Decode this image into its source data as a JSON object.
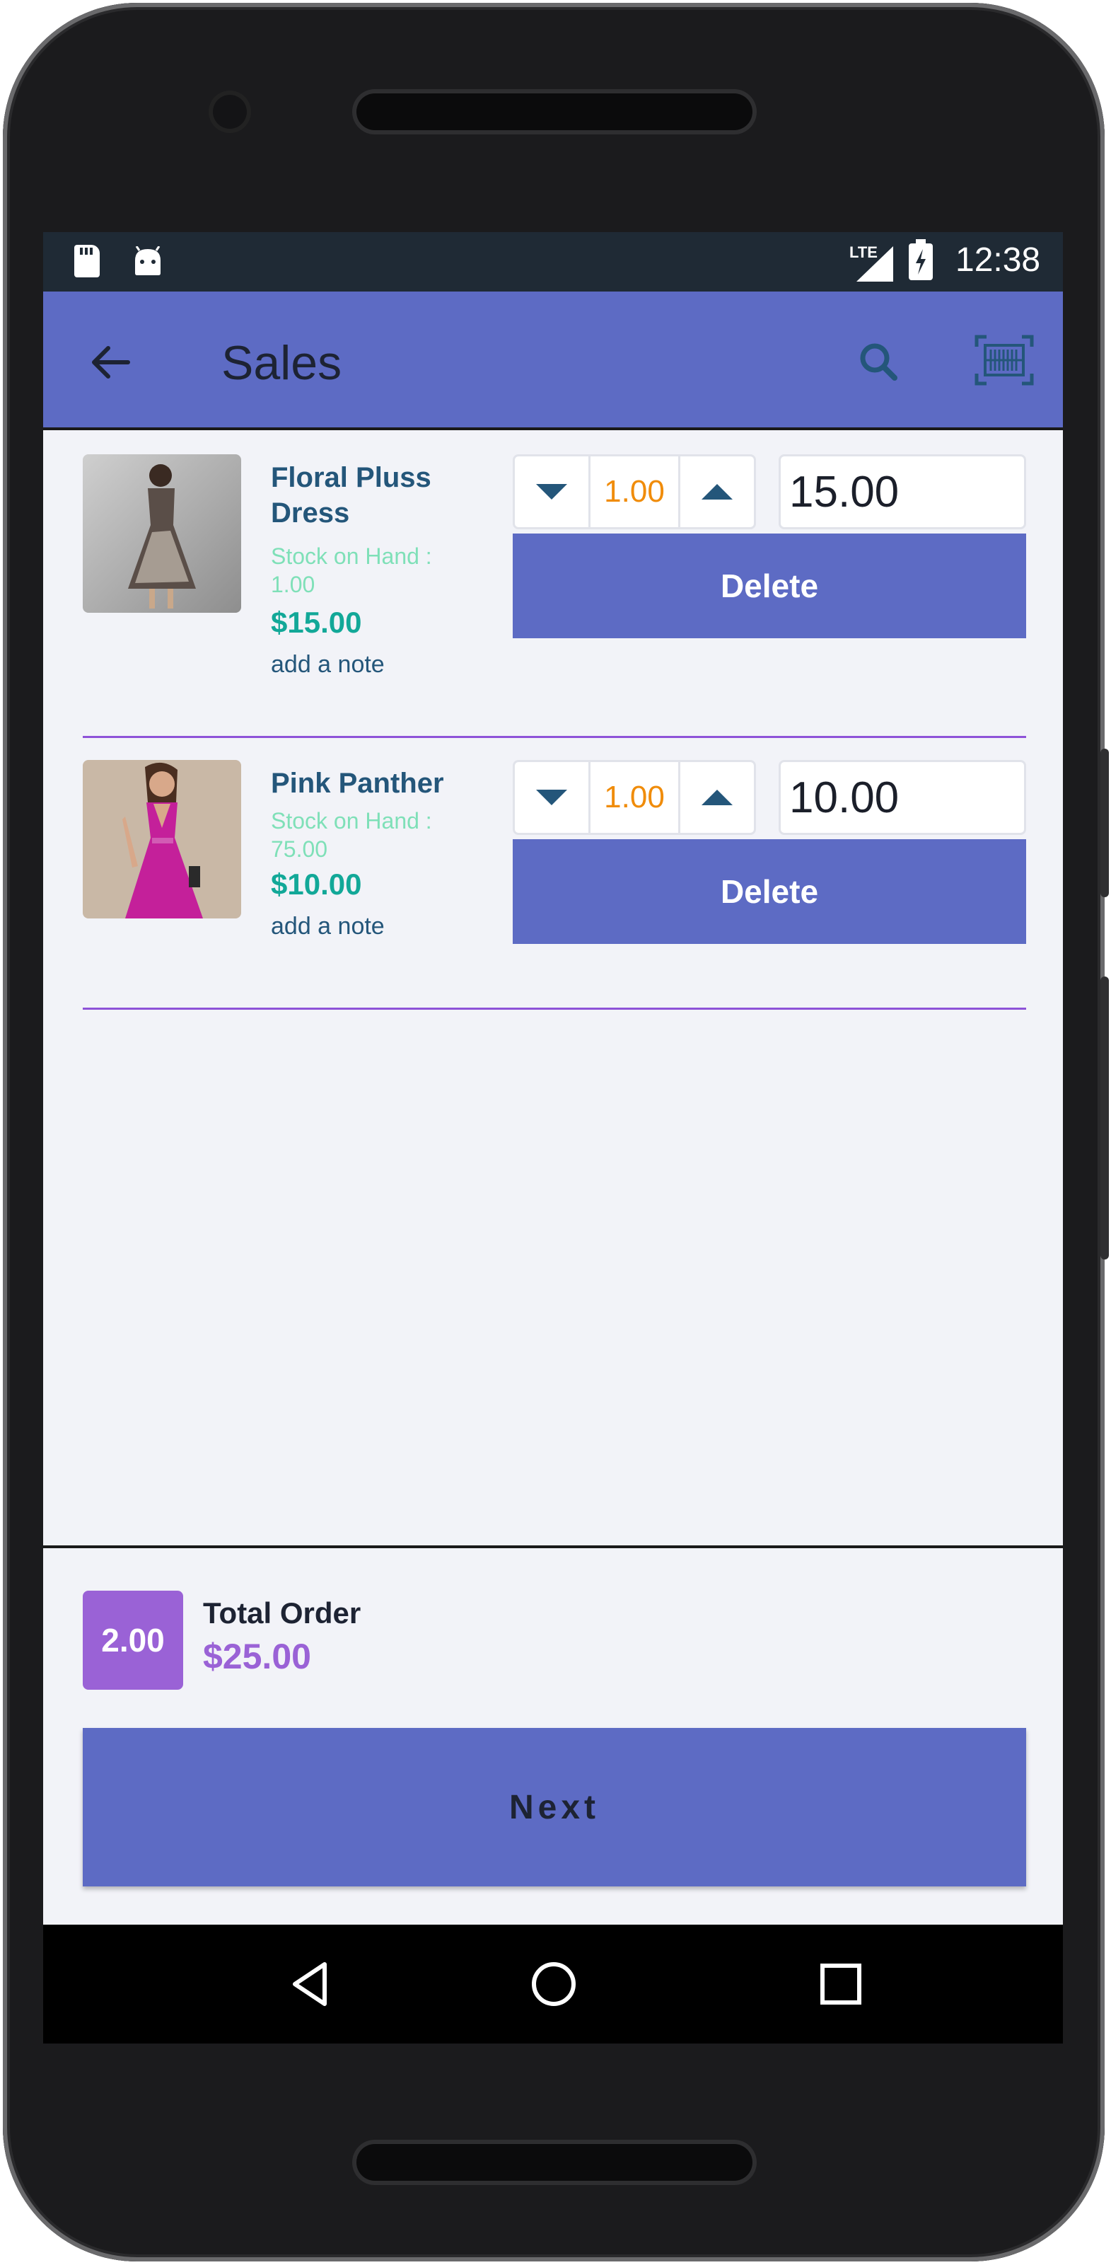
{
  "status_bar": {
    "network": "LTE",
    "time": "12:38"
  },
  "app_bar": {
    "title": "Sales",
    "icons": [
      "back-arrow-icon",
      "search-icon",
      "barcode-scan-icon"
    ]
  },
  "items": [
    {
      "name": "Floral Pluss Dress",
      "stock_label": "Stock on Hand : 1.00",
      "price": "$15.00",
      "note_link": "add a note",
      "quantity": "1.00",
      "unit_price_value": "15.00",
      "delete_label": "Delete",
      "image_colors": {
        "bg": "#b8b8b8",
        "dress": "#5a4e48",
        "accent": "#e6dcd0"
      }
    },
    {
      "name": "Pink Panther",
      "stock_label": "Stock on Hand : 75.00",
      "price": "$10.00",
      "note_link": "add a note",
      "quantity": "1.00",
      "unit_price_value": "10.00",
      "delete_label": "Delete",
      "image_colors": {
        "bg": "#c9b8a6",
        "dress": "#c4209a",
        "accent": "#d25bb4"
      }
    }
  ],
  "footer": {
    "total_qty": "2.00",
    "total_label": "Total Order",
    "total_value": "$25.00",
    "next_label": "Next"
  },
  "colors": {
    "primary": "#5d6bc4",
    "accent_purple": "#9a62d6",
    "price_teal": "#12a898",
    "qty_orange": "#f08c0a",
    "name_blue": "#24567a"
  }
}
